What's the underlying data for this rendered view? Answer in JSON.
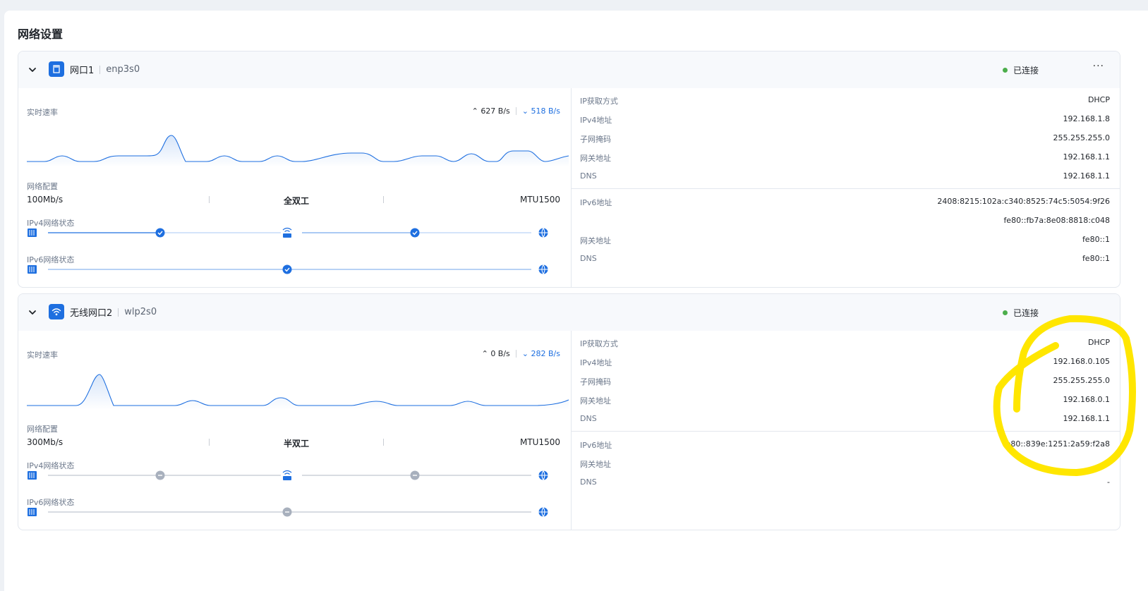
{
  "page": {
    "title": "网络设置"
  },
  "common": {
    "realtime_label": "实时速率",
    "net_config_label": "网络配置",
    "ipv4_state_label": "IPv4网络状态",
    "ipv6_state_label": "IPv6网络状态",
    "more": "···",
    "kv_labels": {
      "ip_method": "IP获取方式",
      "ipv4": "IPv4地址",
      "mask": "子网掩码",
      "gateway": "网关地址",
      "dns": "DNS",
      "ipv6": "IPv6地址"
    }
  },
  "interfaces": [
    {
      "name": "网口1",
      "device": "enp3s0",
      "icon": "ethernet-port-icon",
      "status": "已连接",
      "status_color": "#4cae4c",
      "speed_up": "627 B/s",
      "speed_down": "518 B/s",
      "link_speed": "100Mb/s",
      "duplex": "全双工",
      "mtu": "MTU1500",
      "ipv4_steps": [
        "ok",
        "ok"
      ],
      "ipv6_steps": [
        "ok"
      ],
      "ipv4": {
        "ip_method": "DHCP",
        "ipv4": "192.168.1.8",
        "mask": "255.255.255.0",
        "gateway": "192.168.1.1",
        "dns": "192.168.1.1"
      },
      "ipv6": {
        "addresses": [
          "2408:8215:102a:c340:8525:74c5:5054:9f26",
          "fe80::fb7a:8e08:8818:c048"
        ],
        "gateway": "fe80::1",
        "dns": "fe80::1"
      }
    },
    {
      "name": "无线网口2",
      "device": "wlp2s0",
      "icon": "wifi-icon",
      "status": "已连接",
      "status_color": "#4cae4c",
      "speed_up": "0 B/s",
      "speed_down": "282 B/s",
      "link_speed": "300Mb/s",
      "duplex": "半双工",
      "mtu": "MTU1500",
      "ipv4_steps": [
        "idle",
        "idle"
      ],
      "ipv6_steps": [
        "idle"
      ],
      "ipv4": {
        "ip_method": "DHCP",
        "ipv4": "192.168.0.105",
        "mask": "255.255.255.0",
        "gateway": "192.168.0.1",
        "dns": "192.168.1.1"
      },
      "ipv6": {
        "addresses": [
          "fe80::839e:1251:2a59:f2a8"
        ],
        "gateway": "-",
        "dns": "-"
      }
    }
  ],
  "colors": {
    "accent": "#1e6fe0",
    "idle": "#a8b0bd",
    "annotation": "#ffe600"
  }
}
